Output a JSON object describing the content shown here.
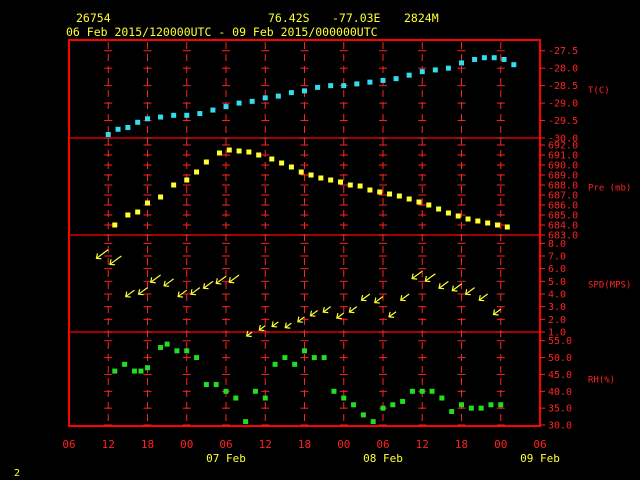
{
  "header": {
    "station": "26754",
    "lat": "76.42S",
    "lon": "-77.03E",
    "elev": "2824M",
    "period": "06 Feb 2015/120000UTC - 09 Feb 2015/000000UTC"
  },
  "footer_number": "2",
  "colors": {
    "frame": "#ff0000",
    "axis": "#ff2222",
    "header": "#ffff33",
    "temperature": "#33ddee",
    "pressure": "#ffff33",
    "wind": "#ffff33",
    "rh": "#22dd22"
  },
  "x_axis": {
    "hour_labels": [
      "06",
      "12",
      "18",
      "00",
      "06",
      "12",
      "18",
      "00",
      "06",
      "12",
      "18",
      "00",
      "06"
    ],
    "date_labels": [
      {
        "label": "07 Feb",
        "hour": 24
      },
      {
        "label": "08 Feb",
        "hour": 48
      },
      {
        "label": "09 Feb",
        "hour": 72
      }
    ],
    "start": "06 Feb 2015 06UTC",
    "range_hours": [
      0,
      72
    ],
    "grid": "dashed vertical every 6h"
  },
  "chart_data": [
    {
      "type": "scatter",
      "title": "T(C)",
      "ylim": [
        -30.0,
        -27.25
      ],
      "ticks": [
        "-27.5",
        "-28.0",
        "-28.5",
        "-29.0",
        "-29.5",
        "-30.0"
      ],
      "x": [
        6,
        7.5,
        9,
        10.5,
        12,
        14,
        16,
        18,
        20,
        22,
        24,
        26,
        28,
        30,
        32,
        34,
        36,
        38,
        40,
        42,
        44,
        46,
        48,
        50,
        52,
        54,
        56,
        58,
        60,
        62,
        63.5,
        65,
        66.5,
        68
      ],
      "y": [
        -29.9,
        -29.75,
        -29.7,
        -29.55,
        -29.45,
        -29.4,
        -29.35,
        -29.35,
        -29.3,
        -29.2,
        -29.1,
        -29.0,
        -28.95,
        -28.85,
        -28.8,
        -28.7,
        -28.65,
        -28.55,
        -28.5,
        -28.5,
        -28.45,
        -28.4,
        -28.35,
        -28.3,
        -28.2,
        -28.1,
        -28.05,
        -28.0,
        -27.85,
        -27.75,
        -27.7,
        -27.7,
        -27.75,
        -27.9
      ]
    },
    {
      "type": "scatter",
      "title": "Pre (mb)",
      "ylim": [
        683.0,
        692.5
      ],
      "ticks": [
        "692.0",
        "691.0",
        "690.0",
        "689.0",
        "688.0",
        "687.0",
        "686.0",
        "685.0",
        "684.0",
        "683.0"
      ],
      "x": [
        7,
        9,
        10.5,
        12,
        14,
        16,
        18,
        19.5,
        21,
        23,
        24.5,
        26,
        27.5,
        29,
        31,
        32.5,
        34,
        35.5,
        37,
        38.5,
        40,
        41.5,
        43,
        44.5,
        46,
        47.5,
        49,
        50.5,
        52,
        53.5,
        55,
        56.5,
        58,
        59.5,
        61,
        62.5,
        64,
        65.5,
        67
      ],
      "y": [
        684.0,
        685.0,
        685.3,
        686.2,
        686.8,
        688.0,
        688.5,
        689.3,
        690.3,
        691.2,
        691.5,
        691.4,
        691.3,
        691.0,
        690.6,
        690.2,
        689.8,
        689.3,
        689.0,
        688.7,
        688.5,
        688.3,
        688.0,
        687.9,
        687.5,
        687.3,
        687.1,
        686.9,
        686.6,
        686.3,
        686.0,
        685.6,
        685.2,
        684.9,
        684.6,
        684.4,
        684.2,
        684.0,
        683.8
      ]
    },
    {
      "type": "scatter",
      "title": "SPD(MPS)",
      "ylim": [
        1.0,
        8.5
      ],
      "ticks": [
        "8.0",
        "7.0",
        "6.0",
        "5.0",
        "4.0",
        "3.0",
        "2.0",
        "1.0"
      ],
      "x": [
        6,
        8,
        10,
        12,
        14,
        16,
        18,
        20,
        22,
        24,
        26,
        28,
        30,
        32,
        34,
        36,
        38,
        40,
        42,
        44,
        46,
        48,
        50,
        52,
        54,
        56,
        58,
        60,
        62,
        64,
        66
      ],
      "y": [
        7.5,
        7.0,
        4.3,
        4.5,
        5.5,
        5.2,
        4.3,
        4.5,
        5.0,
        5.4,
        5.5,
        1.0,
        1.5,
        1.8,
        1.7,
        2.2,
        2.7,
        3.0,
        2.5,
        3.0,
        4.0,
        3.8,
        2.6,
        4.0,
        5.8,
        5.6,
        5.0,
        4.8,
        4.5,
        4.0,
        2.8
      ]
    },
    {
      "type": "scatter",
      "title": "RH(%)",
      "ylim": [
        30.0,
        57.0
      ],
      "ticks": [
        "55.0",
        "50.0",
        "45.0",
        "40.0",
        "35.0",
        "30.0"
      ],
      "x": [
        7,
        8.5,
        10,
        11,
        12,
        14,
        15,
        16.5,
        18,
        19.5,
        21,
        22.5,
        24,
        25.5,
        27,
        28.5,
        30,
        31.5,
        33,
        34.5,
        36,
        37.5,
        39,
        40.5,
        42,
        43.5,
        45,
        46.5,
        48,
        49.5,
        51,
        52.5,
        54,
        55.5,
        57,
        58.5,
        60,
        61.5,
        63,
        64.5,
        66
      ],
      "y": [
        46,
        48,
        46,
        46,
        47,
        53,
        54,
        52,
        52,
        50,
        42,
        42,
        40,
        38,
        31,
        40,
        38,
        48,
        50,
        48,
        52,
        50,
        50,
        40,
        38,
        36,
        33,
        31,
        35,
        36,
        37,
        40,
        40,
        40,
        38,
        34,
        36,
        35,
        35,
        36,
        36
      ]
    }
  ]
}
